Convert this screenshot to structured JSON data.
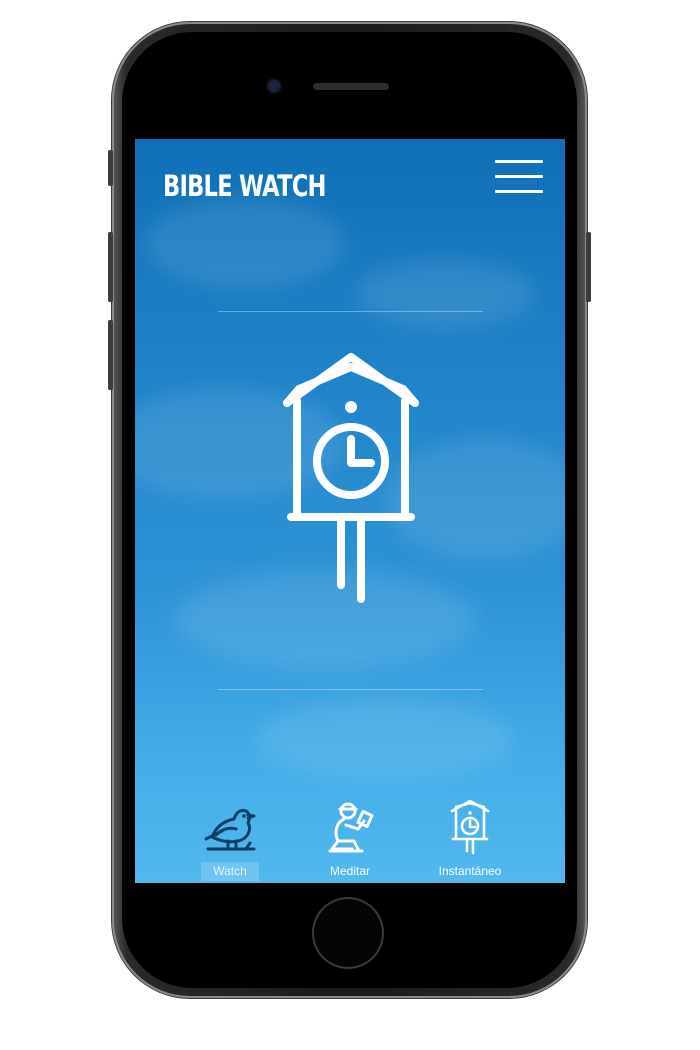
{
  "app": {
    "title": "BIBLE WATCH"
  },
  "menu": {
    "icon": "hamburger-menu-icon"
  },
  "hero": {
    "icon": "cuckoo-clock-icon"
  },
  "tabs": [
    {
      "label": "Watch",
      "icon": "bird-icon",
      "active": true
    },
    {
      "label": "Meditar",
      "icon": "kneeling-reading-person-icon",
      "active": false
    },
    {
      "label": "Instantáneo",
      "icon": "cuckoo-clock-icon",
      "active": false
    }
  ],
  "colors": {
    "sky_top": "#0f6fb6",
    "sky_bottom": "#52b8ee",
    "active_tab_icon": "#0d3f66",
    "foreground": "#ffffff"
  }
}
